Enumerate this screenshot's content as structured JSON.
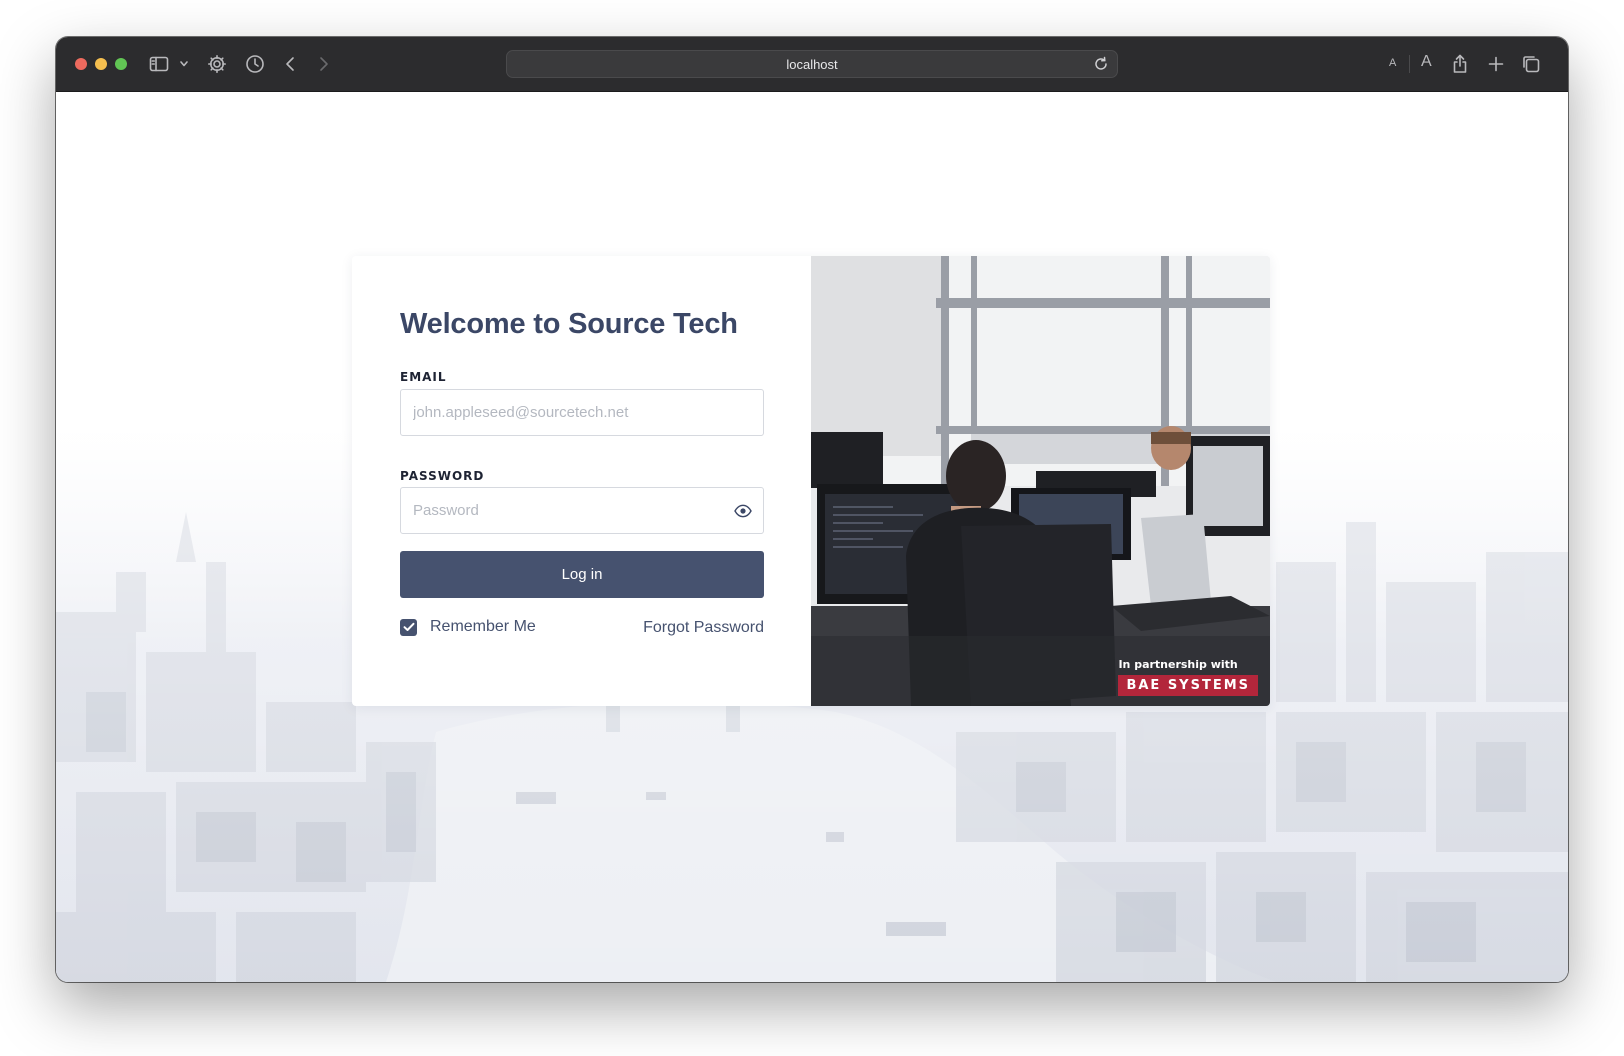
{
  "browser": {
    "address": "localhost",
    "text_size_small": "A",
    "text_size_large": "A",
    "icons": [
      "sidebar-icon",
      "chevron-down-icon",
      "gear-icon",
      "history-icon",
      "back-icon",
      "forward-icon",
      "reload-icon",
      "share-icon",
      "new-tab-icon",
      "tabs-overview-icon"
    ]
  },
  "login": {
    "title": "Welcome to Source Tech",
    "email_label": "EMAIL",
    "email_placeholder": "john.appleseed@sourcetech.net",
    "email_value": "",
    "password_label": "PASSWORD",
    "password_placeholder": "Password",
    "password_value": "",
    "login_button": "Log in",
    "remember_me": "Remember Me",
    "remember_checked": true,
    "forgot_password": "Forgot Password"
  },
  "promo": {
    "partner_text": "In partnership with",
    "partner_logo": "BAE SYSTEMS"
  },
  "colors": {
    "accent": "#46526f",
    "title": "#3b4766",
    "logo_red": "#b3263b",
    "toolbar": "#2c2c2e"
  }
}
